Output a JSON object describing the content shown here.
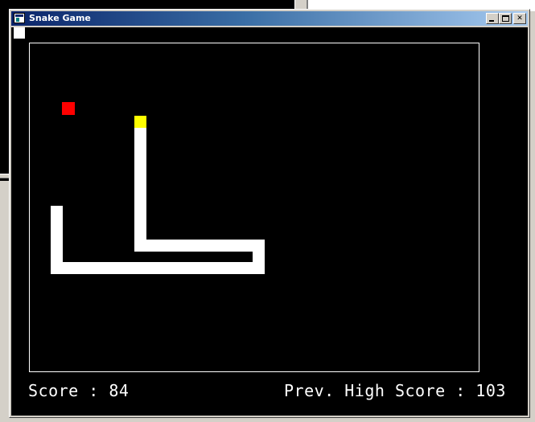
{
  "window": {
    "title": "Snake Game",
    "controls": [
      "minimize",
      "maximize",
      "close"
    ],
    "close_glyph": "✕"
  },
  "game": {
    "score_label": "Score : 84",
    "high_score_label": "Prev. High Score : 103",
    "score": 84,
    "previous_high_score": 103,
    "colors": {
      "background": "#000000",
      "snake": "#ffffff",
      "snake_head": "#ffff00",
      "food": "#ff0000",
      "border": "#ffffff"
    }
  }
}
